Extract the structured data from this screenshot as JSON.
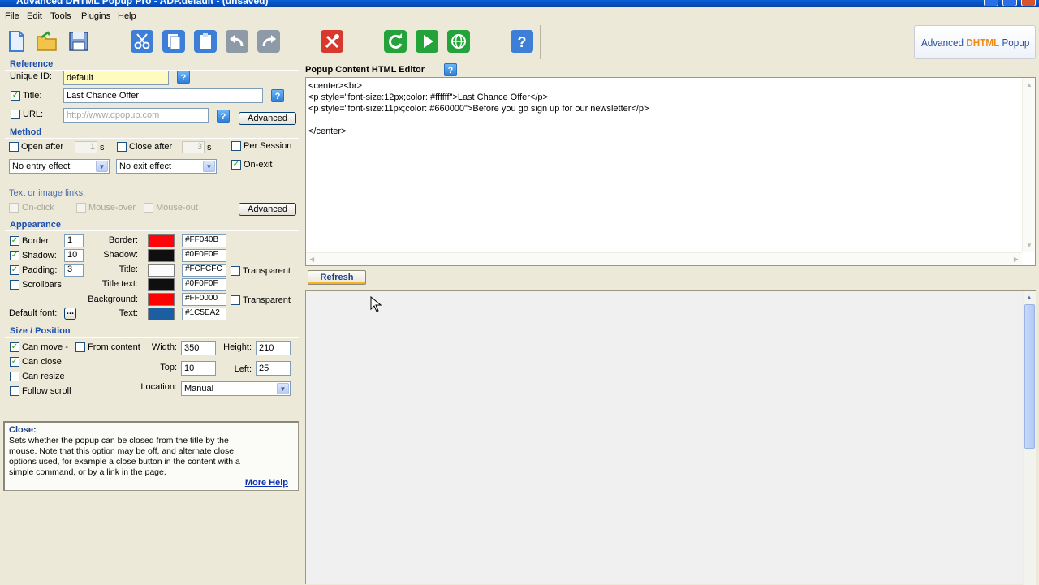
{
  "window": {
    "title": "Advanced DHTML Popup Pro - ADP.default - (unsaved)"
  },
  "menu": [
    "File",
    "Edit",
    "Tools",
    "Plugins",
    "Help"
  ],
  "toolbar": {
    "buttons": [
      "new-file-icon",
      "open-folder-icon",
      "save-disk-icon",
      "cut-icon",
      "copy-icon",
      "paste-icon",
      "undo-icon",
      "redo-icon",
      "tools-icon",
      "refresh-icon",
      "play-icon",
      "globe-icon",
      "help-icon"
    ],
    "colors": {
      "blue": "#3d7fd6",
      "red": "#d8382d",
      "green": "#24a33a"
    }
  },
  "logo": {
    "part1": "Advanced ",
    "part2": "DHTML",
    "part3": " Popup"
  },
  "reference": {
    "title": "Reference",
    "unique_id_label": "Unique ID:",
    "unique_id_value": "default",
    "title_label": "Title:",
    "title_value": "Last Chance Offer",
    "url_label": "URL:",
    "url_placeholder": "http://www.dpopup.com",
    "advanced": "Advanced"
  },
  "method": {
    "title": "Method",
    "open_after": "Open after",
    "open_after_value": "1",
    "close_after": "Close after",
    "close_after_value": "3",
    "seconds": "s",
    "per_session": "Per Session",
    "on_exit": "On-exit",
    "entry_effect": "No entry effect",
    "exit_effect": "No exit effect",
    "links_label": "Text or image links:",
    "on_click": "On-click",
    "mouse_over": "Mouse-over",
    "mouse_out": "Mouse-out",
    "advanced": "Advanced"
  },
  "appearance": {
    "title": "Appearance",
    "border_label": "Border:",
    "border_value": "1",
    "shadow_label": "Shadow:",
    "shadow_value": "10",
    "padding_label": "Padding:",
    "padding_value": "3",
    "scrollbars_label": "Scrollbars",
    "default_font_label": "Default font:",
    "font_button": "...",
    "colors": [
      {
        "label": "Border:",
        "hex": "#FF040B",
        "swatch": "#FF040B"
      },
      {
        "label": "Shadow:",
        "hex": "#0F0F0F",
        "swatch": "#0F0F0F"
      },
      {
        "label": "Title:",
        "hex": "#FCFCFC",
        "swatch": "#FCFCFC"
      },
      {
        "label": "Title text:",
        "hex": "#0F0F0F",
        "swatch": "#0F0F0F"
      },
      {
        "label": "Background:",
        "hex": "#FF0000",
        "swatch": "#FF0000"
      },
      {
        "label": "Text:",
        "hex": "#1C5EA2",
        "swatch": "#1C5EA2"
      }
    ],
    "transparent": "Transparent"
  },
  "size_position": {
    "title": "Size / Position",
    "can_move": "Can move -",
    "from_content": "From content",
    "can_close": "Can close",
    "can_resize": "Can resize",
    "follow_scroll": "Follow scroll",
    "width_label": "Width:",
    "width_value": "350",
    "height_label": "Height:",
    "height_value": "210",
    "top_label": "Top:",
    "top_value": "10",
    "left_label": "Left:",
    "left_value": "25",
    "location_label": "Location:",
    "location_value": "Manual"
  },
  "help_box": {
    "title": "Close:",
    "body": "Sets whether the popup can be closed from the title by the mouse. Note that this option may be off, and alternate close options used, for example a close button in the content with a simple command, or by a link in the page.",
    "more": "More Help"
  },
  "editor": {
    "title": "Popup Content HTML Editor",
    "content": "<center><br>\n<p style=\"font-size:12px;color: #ffffff\">Last Chance Offer</p>\n<p style=\"font-size:11px;color: #660000\">Before you go sign up for our newsletter</p>\n\n</center>",
    "refresh": "Refresh"
  }
}
